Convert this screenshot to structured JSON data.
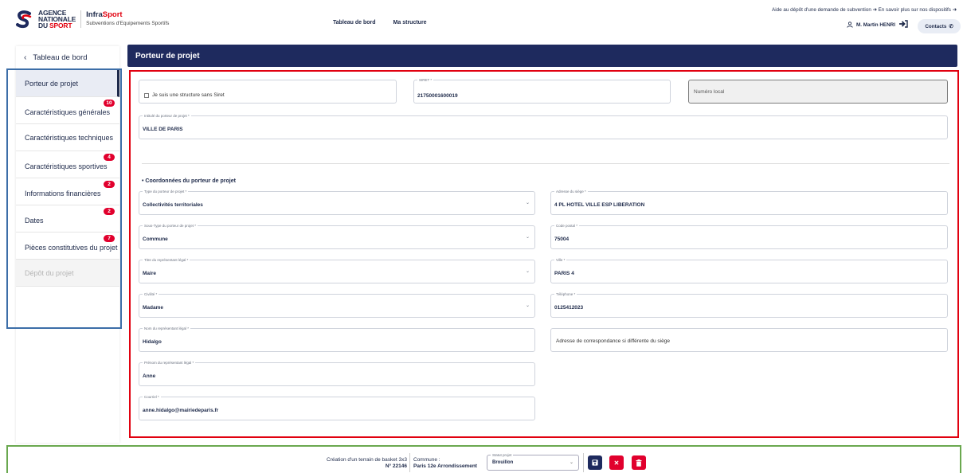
{
  "header": {
    "logo_line1": "AGENCE",
    "logo_line2": "NATIONALE",
    "logo_line3a": "DU ",
    "logo_line3b": "SPORT",
    "brand_a": "Infra",
    "brand_b": "Sport",
    "brand_sub": "Subventions d'Equipements Sportifs",
    "nav": [
      "Tableau de bord",
      "Ma structure"
    ],
    "help_1": "Aide au dépôt d'une demande de subvention",
    "help_2": "En savoir plus sur nos dispositifs",
    "user": "M. Martin HENRI",
    "contacts": "Contacts"
  },
  "sidebar": {
    "back": "Tableau de bord",
    "items": [
      {
        "label": "Porteur de projet",
        "badge": ""
      },
      {
        "label": "Caractéristiques générales",
        "badge": "10"
      },
      {
        "label": "Caractéristiques techniques",
        "badge": ""
      },
      {
        "label": "Caractéristiques sportives",
        "badge": "4"
      },
      {
        "label": "Informations financières",
        "badge": "2"
      },
      {
        "label": "Dates",
        "badge": "2"
      },
      {
        "label": "Pièces constitutives du projet",
        "badge": "7"
      },
      {
        "label": "Dépôt du projet",
        "badge": ""
      }
    ]
  },
  "main": {
    "title": "Porteur de projet",
    "no_siret_label": "Je suis une structure sans Siret",
    "siret": {
      "label": "SIRET *",
      "value": "21750001600019"
    },
    "numero_local": {
      "placeholder": "Numéro local"
    },
    "intitule": {
      "label": "Intitulé du porteur de projet *",
      "value": "VILLE DE PARIS"
    },
    "section": "Coordonnées du porteur de projet",
    "left_fields": [
      {
        "label": "Type du porteur de projet *",
        "value": "Collectivités territoriales"
      },
      {
        "label": "Sous-Type du porteur de projet *",
        "value": "Commune"
      },
      {
        "label": "Titre du représentant légal *",
        "value": "Maire"
      },
      {
        "label": "Civilité *",
        "value": "Madame"
      },
      {
        "label": "Nom du représentant légal *",
        "value": "Hidalgo"
      },
      {
        "label": "Prénom du représentant légal *",
        "value": "Anne"
      },
      {
        "label": "Courriel *",
        "value": "anne.hidalgo@mairiedeparis.fr"
      }
    ],
    "right_fields": [
      {
        "label": "Adresse du siège *",
        "value": "4 PL HOTEL VILLE ESP LIBERATION"
      },
      {
        "label": "Code postal *",
        "value": "75004"
      },
      {
        "label": "Ville *",
        "value": "PARIS 4"
      },
      {
        "label": "Téléphone *",
        "value": "0125412023"
      }
    ],
    "adresse_corresp": "Adresse de correspondance si différente du siège"
  },
  "footer": {
    "project_name": "Création d'un terrain de basket 3x3",
    "project_no": "N° 22146",
    "commune_label": "Commune :",
    "commune_value": "Paris 12e Arrondissement",
    "statut_label": "Statut projet",
    "statut_value": "Brouillon"
  },
  "colors": {
    "navy": "#1e2a5e",
    "red": "#e1000f",
    "badge": "#e1002d"
  }
}
